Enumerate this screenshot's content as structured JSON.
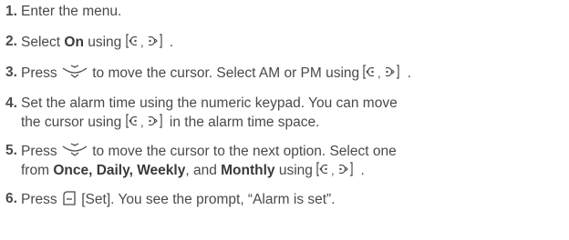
{
  "steps": [
    {
      "number": "1.",
      "text": "Enter the menu."
    },
    {
      "number": "2.",
      "pre": "Select ",
      "bold": "On",
      "mid": " using ",
      "post": "."
    },
    {
      "number": "3.",
      "pre": "Press ",
      "mid": " to move the cursor. Select AM or PM using ",
      "post": "."
    },
    {
      "number": "4.",
      "line1": "Set the alarm time using the numeric keypad. You can move",
      "line2_pre": "the cursor using ",
      "line2_post": " in the alarm time space."
    },
    {
      "number": "5.",
      "pre": "Press ",
      "mid": " to move the cursor to the next option. Select one",
      "line2_pre": "from ",
      "b1": "Once, Daily, Weekly",
      "s1": ", and ",
      "b2": "Monthly",
      "line2_mid": " using ",
      "post": "."
    },
    {
      "number": "6.",
      "pre": "Press ",
      "rest": " [Set]. You see the prompt, “Alarm is set”."
    }
  ],
  "icons": {
    "nav": "left-right-navigation-key-icon",
    "ok": "ok-navigation-key-icon",
    "softkey": "left-soft-key-icon"
  },
  "colors": {
    "text": "#4a4a4a",
    "bold": "#3a3a3a"
  }
}
